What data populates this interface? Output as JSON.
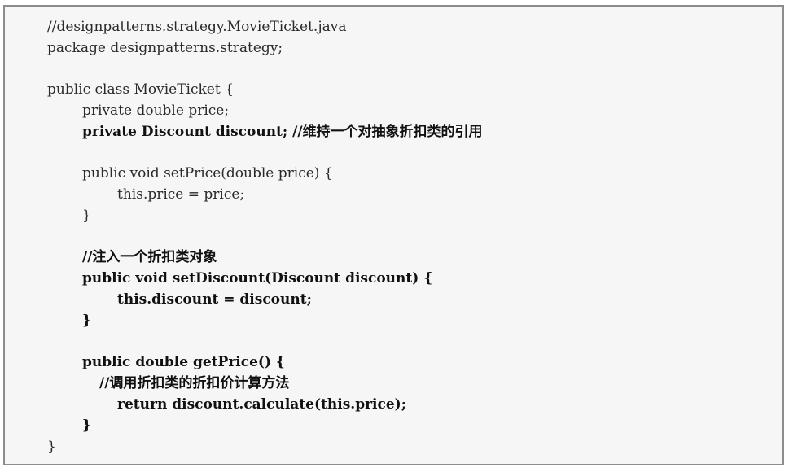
{
  "code": {
    "comment_file": "//designpatterns.strategy.MovieTicket.java",
    "package_decl": "package designpatterns.strategy;",
    "class_decl": "public class MovieTicket {",
    "field_price": "private double price;",
    "field_discount": "private Discount discount; //维持一个对抽象折扣类的引用",
    "setprice_sig": "public void setPrice(double price) {",
    "setprice_body": "this.price = price;",
    "setprice_close": "}",
    "comment_inject": "//注入一个折扣类对象",
    "setdiscount_sig": "public void setDiscount(Discount discount) {",
    "setdiscount_body": "this.discount = discount;",
    "setdiscount_close": "}",
    "getprice_sig": "public double getPrice() {",
    "comment_calc": "//调用折扣类的折扣价计算方法",
    "getprice_return": "return discount.calculate(this.price);",
    "getprice_close": "}",
    "class_close": "}"
  }
}
